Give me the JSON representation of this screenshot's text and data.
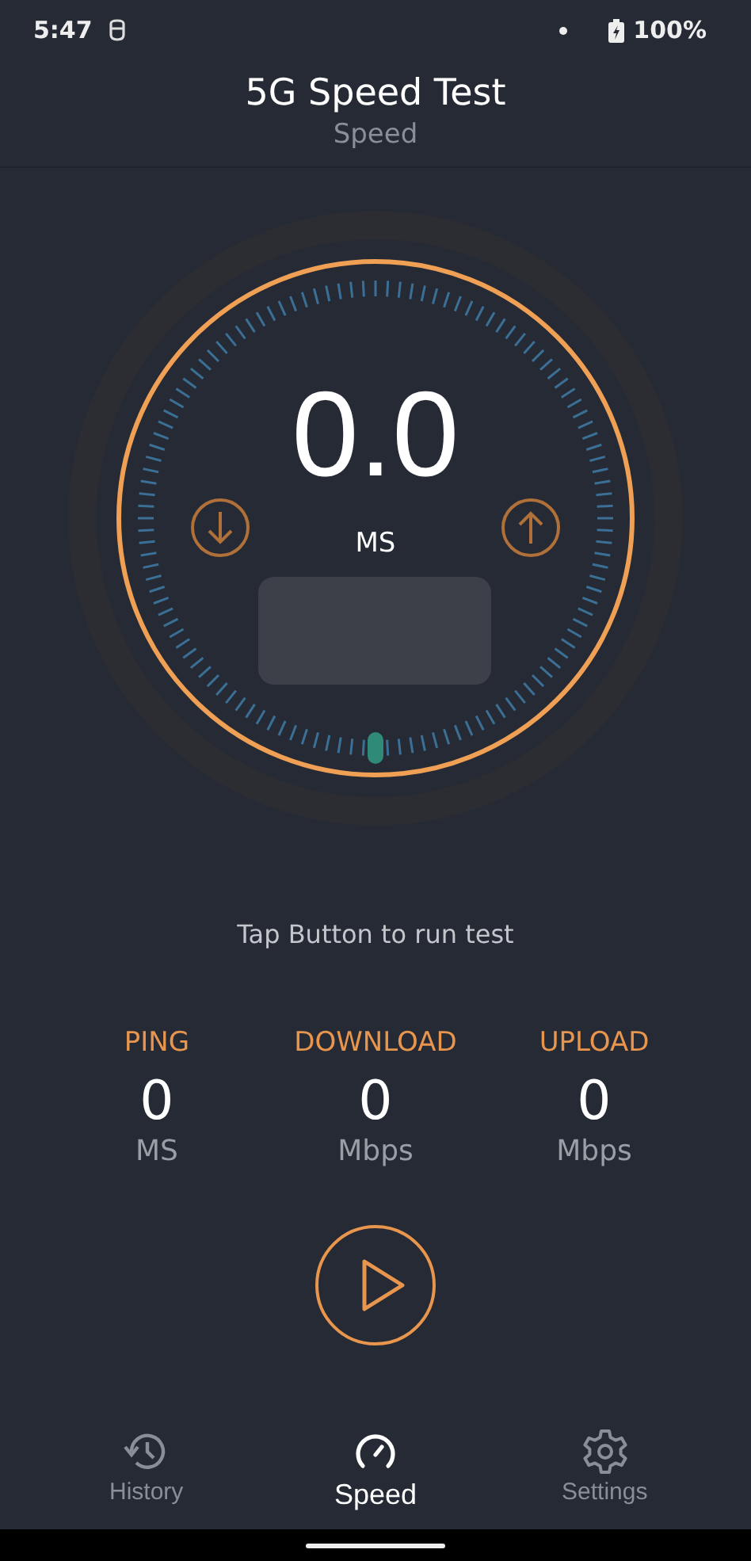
{
  "status_bar": {
    "time": "5:47",
    "battery": "100%"
  },
  "header": {
    "title": "5G Speed Test",
    "subtitle": "Speed"
  },
  "gauge": {
    "value": "0.0",
    "unit": "MS"
  },
  "hint": "Tap Button to run test",
  "stats": [
    {
      "label": "PING",
      "value": "0",
      "unit": "MS"
    },
    {
      "label": "DOWNLOAD",
      "value": "0",
      "unit": "Mbps"
    },
    {
      "label": "UPLOAD",
      "value": "0",
      "unit": "Mbps"
    }
  ],
  "nav": [
    {
      "label": "History",
      "kind": "history",
      "selected": false
    },
    {
      "label": "Speed",
      "kind": "speed",
      "selected": true
    },
    {
      "label": "Settings",
      "kind": "settings",
      "selected": false
    }
  ]
}
